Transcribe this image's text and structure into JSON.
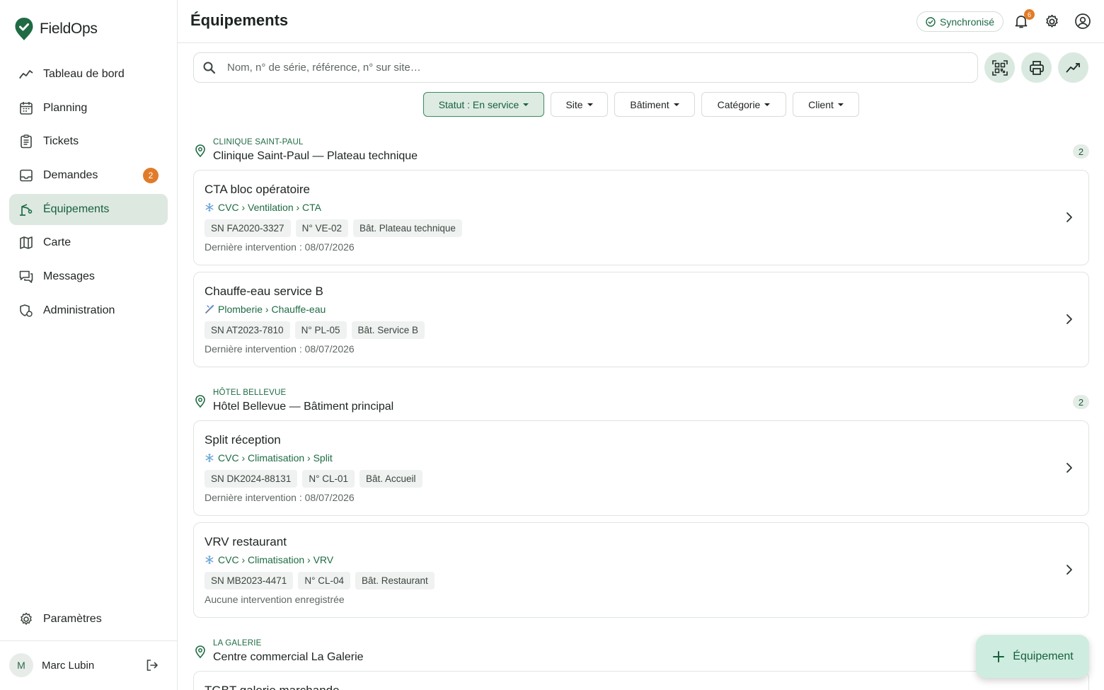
{
  "app": {
    "brand": "FieldOps",
    "accent": "#1e6b44",
    "badge_color": "#e07c29"
  },
  "sidebar": {
    "items": [
      {
        "label": "Tableau de bord",
        "icon": "trend-line-icon"
      },
      {
        "label": "Planning",
        "icon": "calendar-icon"
      },
      {
        "label": "Tickets",
        "icon": "clipboard-icon"
      },
      {
        "label": "Demandes",
        "icon": "inbox-icon",
        "badge": "2"
      },
      {
        "label": "Équipements",
        "icon": "equipment-icon",
        "active": true
      },
      {
        "label": "Carte",
        "icon": "map-icon"
      },
      {
        "label": "Messages",
        "icon": "chat-icon"
      },
      {
        "label": "Administration",
        "icon": "admin-icon"
      }
    ],
    "settings_label": "Paramètres",
    "user": {
      "initial": "M",
      "name": "Marc Lubin"
    }
  },
  "header": {
    "title": "Équipements",
    "sync_label": "Synchronisé",
    "notification_count": "6"
  },
  "search": {
    "placeholder": "Nom, n° de série, référence, n° sur site…",
    "value": ""
  },
  "filters": [
    {
      "label": "Statut : En service",
      "active": true
    },
    {
      "label": "Site"
    },
    {
      "label": "Bâtiment"
    },
    {
      "label": "Catégorie"
    },
    {
      "label": "Client"
    }
  ],
  "groups": [
    {
      "overline": "CLINIQUE SAINT-PAUL",
      "name": "Clinique Saint-Paul — Plateau technique",
      "count": "2",
      "items": [
        {
          "name": "CTA bloc opératoire",
          "category_icon": "snowflake-icon",
          "category": "CVC › Ventilation › CTA",
          "serial": "SN FA2020-3327",
          "site_no": "N° VE-02",
          "building": "Bât. Plateau technique",
          "last": "Dernière intervention : 08/07/2026"
        },
        {
          "name": "Chauffe-eau service B",
          "category_icon": "wrench-icon",
          "category": "Plomberie › Chauffe-eau",
          "serial": "SN AT2023-7810",
          "site_no": "N° PL-05",
          "building": "Bât. Service B",
          "last": "Dernière intervention : 08/07/2026"
        }
      ]
    },
    {
      "overline": "HÔTEL BELLEVUE",
      "name": "Hôtel Bellevue — Bâtiment principal",
      "count": "2",
      "items": [
        {
          "name": "Split réception",
          "category_icon": "snowflake-icon",
          "category": "CVC › Climatisation › Split",
          "serial": "SN DK2024-88131",
          "site_no": "N° CL-01",
          "building": "Bât. Accueil",
          "last": "Dernière intervention : 08/07/2026"
        },
        {
          "name": "VRV restaurant",
          "category_icon": "snowflake-icon",
          "category": "CVC › Climatisation › VRV",
          "serial": "SN MB2023-4471",
          "site_no": "N° CL-04",
          "building": "Bât. Restaurant",
          "last": "Aucune intervention enregistrée"
        }
      ]
    },
    {
      "overline": "LA GALERIE",
      "name": "Centre commercial La Galerie",
      "items": [
        {
          "name": "TGBT galerie marchande"
        }
      ]
    }
  ],
  "fab": {
    "label": "Équipement"
  }
}
